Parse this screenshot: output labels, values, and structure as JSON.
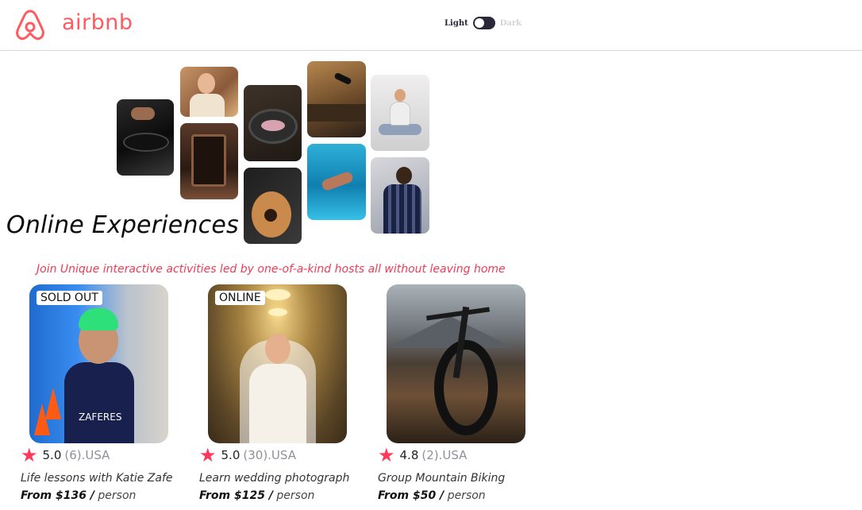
{
  "header": {
    "brand": "airbnb",
    "theme_toggle": {
      "light_label": "Light",
      "dark_label": "Dark",
      "state": "light"
    }
  },
  "hero": {
    "title": "Online Experiences",
    "subtitle": "Join Unique interactive activities led by one-of-a-kind hosts all without leaving home"
  },
  "cards": [
    {
      "badge": "SOLD OUT",
      "rating": "5.0",
      "meta": "(6).USA",
      "title": "Life lessons with Katie Zafe",
      "price": "From $136 /",
      "unit": "person"
    },
    {
      "badge": "ONLINE",
      "rating": "5.0",
      "meta": "(30).USA",
      "title": "Learn wedding photograph",
      "price": "From $125 /",
      "unit": "person"
    },
    {
      "rating": "4.8",
      "meta": "(2).USA",
      "title": "Group Mountain Biking",
      "price": "From $50 /",
      "unit": "person"
    }
  ],
  "colors": {
    "brand": "#ff5a5f",
    "accent": "#f23a55",
    "star": "#fe395c"
  },
  "icons": {
    "logo": "airbnb-logo-icon",
    "star": "star-icon"
  }
}
